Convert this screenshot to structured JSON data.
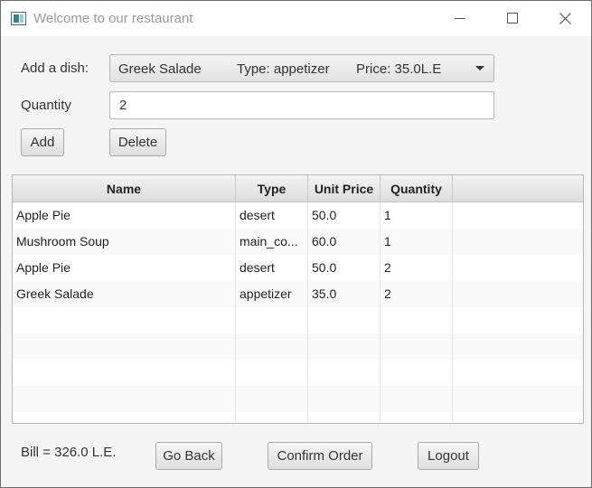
{
  "window": {
    "title": "Welcome to our restaurant"
  },
  "form": {
    "dish_label": "Add a dish:",
    "dish_select": {
      "name": "Greek Salade",
      "type": "Type: appetizer",
      "price": "Price: 35.0L.E"
    },
    "quantity_label": "Quantity",
    "quantity_value": "2",
    "add_label": "Add",
    "delete_label": "Delete"
  },
  "table": {
    "columns": [
      "Name",
      "Type",
      "Unit Price",
      "Quantity"
    ],
    "rows": [
      {
        "name": "Apple Pie",
        "type": "desert",
        "unit_price": "50.0",
        "quantity": "1"
      },
      {
        "name": "Mushroom Soup",
        "type": "main_co...",
        "unit_price": "60.0",
        "quantity": "1"
      },
      {
        "name": "Apple Pie",
        "type": "desert",
        "unit_price": "50.0",
        "quantity": "2"
      },
      {
        "name": "Greek Salade",
        "type": "appetizer",
        "unit_price": "35.0",
        "quantity": "2"
      }
    ]
  },
  "footer": {
    "bill": "Bill = 326.0 L.E.",
    "go_back_label": "Go Back",
    "confirm_label": "Confirm Order",
    "logout_label": "Logout"
  }
}
